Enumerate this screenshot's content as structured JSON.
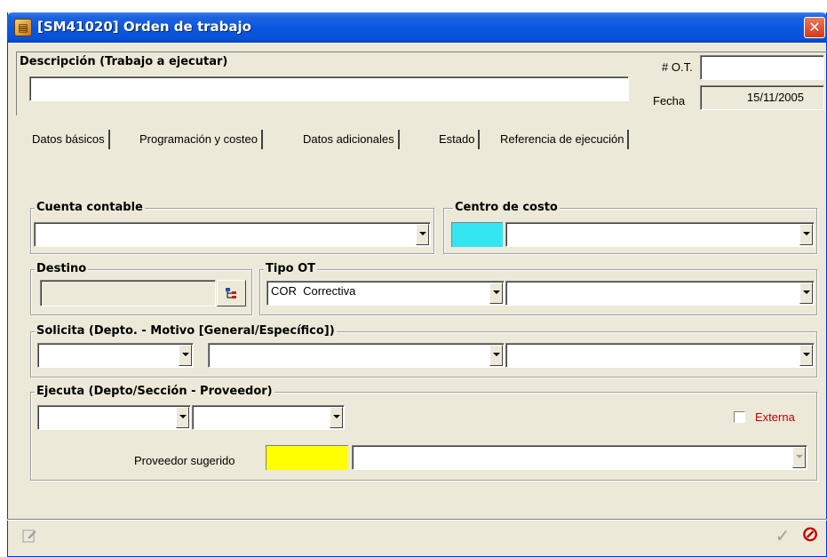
{
  "window": {
    "title": "[SM41020] Orden de trabajo",
    "icon": "app-icon",
    "close_icon": "close-icon",
    "close_glyph": "✕"
  },
  "header": {
    "descripcion_label": "Descripción (Trabajo a ejecutar)",
    "descripcion_value": "",
    "ot_label": "# O.T.",
    "ot_value": "",
    "fecha_label": "Fecha",
    "fecha_value": "15/11/2005"
  },
  "tabs": [
    {
      "label": "Datos básicos",
      "active": true
    },
    {
      "label": "Programación y costeo",
      "active": false
    },
    {
      "label": "Datos adicionales",
      "active": false
    },
    {
      "label": "Estado",
      "active": false
    },
    {
      "label": "Referencia de ejecución",
      "active": false
    }
  ],
  "cuenta_contable": {
    "legend": "Cuenta contable",
    "value": ""
  },
  "centro_costo": {
    "legend": "Centro de costo",
    "code_color": "#33e5f0",
    "value": ""
  },
  "destino": {
    "legend": "Destino",
    "value": "",
    "button_icon": "tree-picker-icon"
  },
  "tipo_ot": {
    "legend": "Tipo OT",
    "code": "COR",
    "name": "Correctiva",
    "detail": ""
  },
  "solicita": {
    "legend": "Solicita (Depto. - Motivo [General/Específico])",
    "depto": "",
    "motivo_general": "",
    "motivo_especifico": ""
  },
  "ejecuta": {
    "legend": "Ejecuta (Depto/Sección - Proveedor)",
    "depto": "",
    "seccion": "",
    "externa_label": "Externa",
    "externa_checked": false,
    "externa_color": "#c00000",
    "proveedor_label": "Proveedor sugerido",
    "proveedor_code_color": "#ffff00",
    "proveedor_value": ""
  },
  "footer": {
    "edit_icon": "edit-note-icon",
    "confirm_icon": "checkmark-icon",
    "confirm_glyph": "✓",
    "cancel_icon": "cancel-icon",
    "cancel_glyph": "⊘"
  }
}
